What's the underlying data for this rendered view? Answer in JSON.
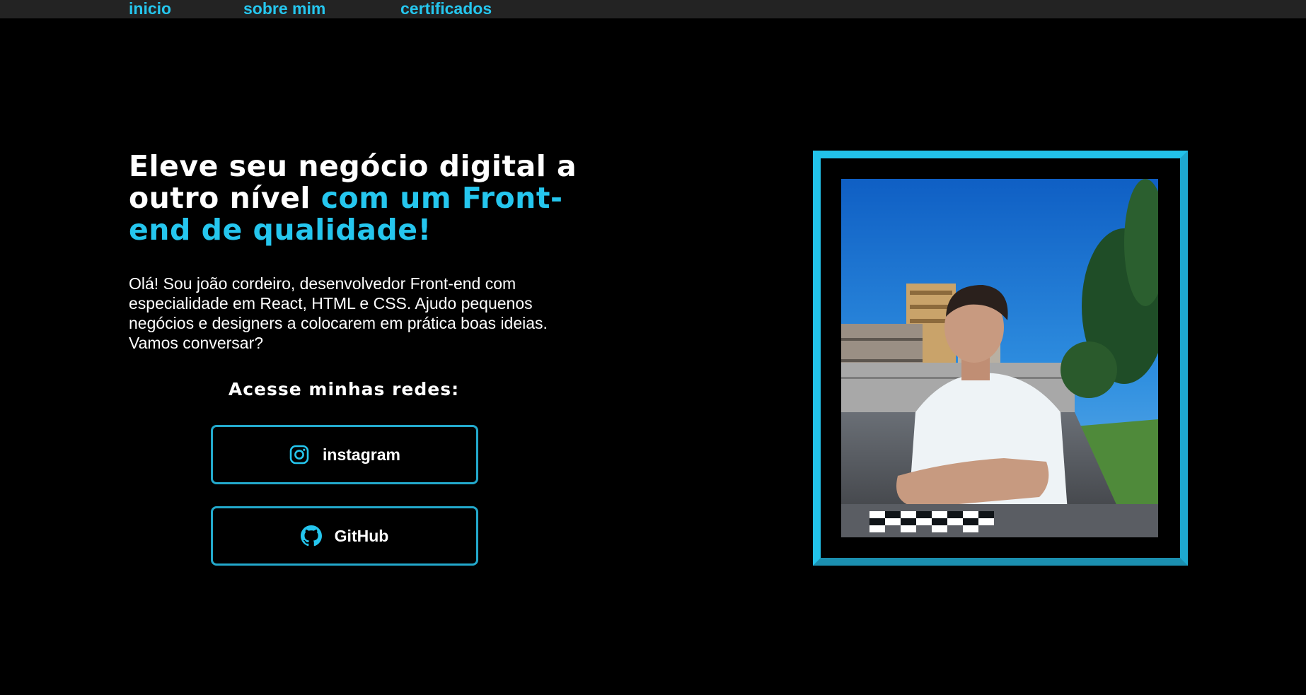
{
  "nav": {
    "items": [
      {
        "label": "inicio"
      },
      {
        "label": "sobre mim"
      },
      {
        "label": "certificados"
      }
    ]
  },
  "hero": {
    "headline_white": "Eleve seu negócio digital a outro nível ",
    "headline_accent": "com um Front-end de qualidade!",
    "intro": "Olá! Sou joão cordeiro, desenvolvedor Front-end com especialidade em React, HTML e CSS. Ajudo pequenos negócios e designers a colocarem em prática boas ideias. Vamos conversar?",
    "social_heading": "Acesse minhas redes:",
    "social_links": [
      {
        "label": "instagram",
        "icon": "instagram-icon"
      },
      {
        "label": "GitHub",
        "icon": "github-icon"
      }
    ]
  },
  "photo": {
    "alt": "profile photo"
  },
  "colors": {
    "background": "#000000",
    "nav_background": "#232323",
    "accent": "#25c6ee",
    "button_border": "#23a9cc",
    "text": "#ffffff"
  }
}
